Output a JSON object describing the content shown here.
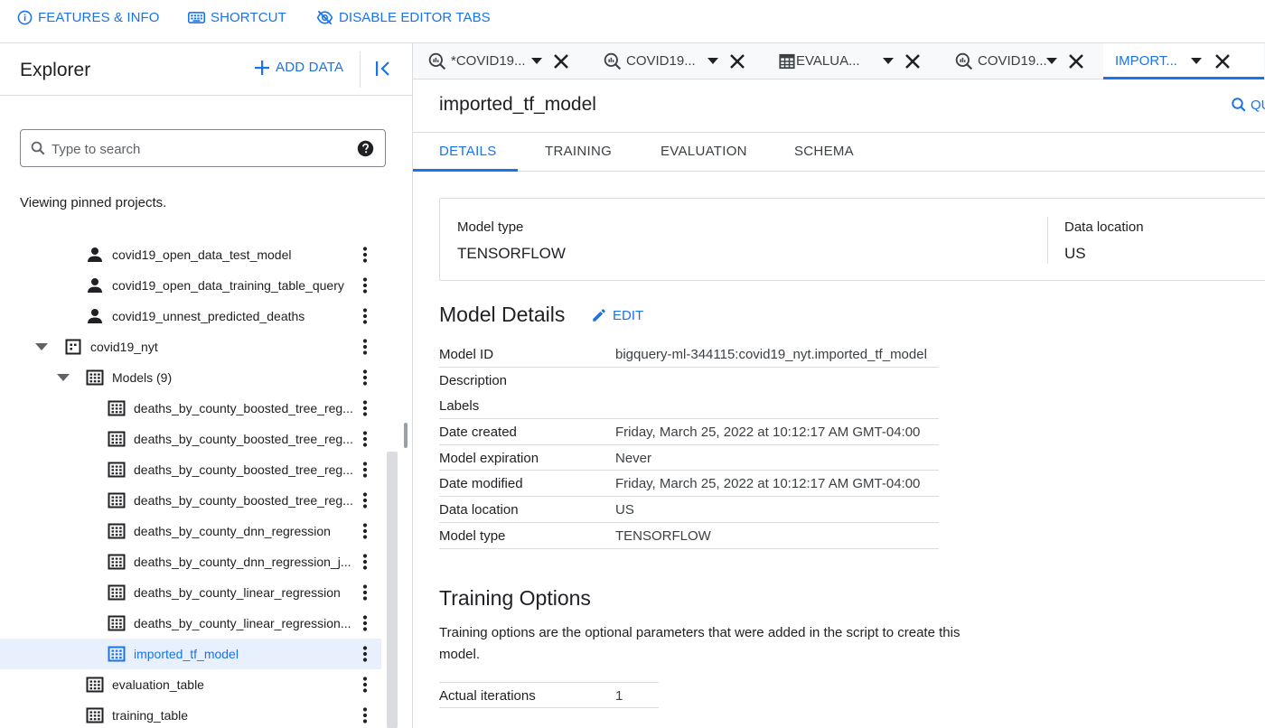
{
  "toolbar": {
    "features_info": "FEATURES & INFO",
    "shortcut": "SHORTCUT",
    "disable_tabs": "DISABLE EDITOR TABS"
  },
  "explorer": {
    "title": "Explorer",
    "add_data": "ADD DATA",
    "search_placeholder": "Type to search",
    "pinned_text": "Viewing pinned projects.",
    "tree": [
      {
        "label": "covid19_open_data_test_model",
        "icon": "person-icon",
        "indent": 1
      },
      {
        "label": "covid19_open_data_training_table_query",
        "icon": "person-icon",
        "indent": 1
      },
      {
        "label": "covid19_unnest_predicted_deaths",
        "icon": "person-icon",
        "indent": 1
      },
      {
        "label": "covid19_nyt",
        "icon": "dataset-icon",
        "indent": 0,
        "expanded": true
      },
      {
        "label": "Models (9)",
        "icon": "model-folder-icon",
        "indent": 1,
        "expanded": true
      },
      {
        "label": "deaths_by_county_boosted_tree_reg...",
        "icon": "model-icon",
        "indent": 2
      },
      {
        "label": "deaths_by_county_boosted_tree_reg...",
        "icon": "model-icon",
        "indent": 2
      },
      {
        "label": "deaths_by_county_boosted_tree_reg...",
        "icon": "model-icon",
        "indent": 2
      },
      {
        "label": "deaths_by_county_boosted_tree_reg...",
        "icon": "model-icon",
        "indent": 2
      },
      {
        "label": "deaths_by_county_dnn_regression",
        "icon": "model-icon",
        "indent": 2
      },
      {
        "label": "deaths_by_county_dnn_regression_j...",
        "icon": "model-icon",
        "indent": 2
      },
      {
        "label": "deaths_by_county_linear_regression",
        "icon": "model-icon",
        "indent": 2
      },
      {
        "label": "deaths_by_county_linear_regression...",
        "icon": "model-icon",
        "indent": 2
      },
      {
        "label": "imported_tf_model",
        "icon": "model-icon",
        "indent": 2,
        "selected": true
      },
      {
        "label": "evaluation_table",
        "icon": "table-icon",
        "indent": 1
      },
      {
        "label": "training_table",
        "icon": "table-icon",
        "indent": 1
      }
    ]
  },
  "editor_tabs": [
    {
      "label": "*COVID19...",
      "icon": "query-icon"
    },
    {
      "label": "COVID19...",
      "icon": "query-icon"
    },
    {
      "label": "EVALUA...",
      "icon": "table-icon"
    },
    {
      "label": "COVID19...",
      "icon": "query-icon"
    },
    {
      "label": "IMPORT...",
      "icon": "none",
      "active": true
    }
  ],
  "model": {
    "title": "imported_tf_model",
    "query_label": "QU",
    "subtabs": [
      "DETAILS",
      "TRAINING",
      "EVALUATION",
      "SCHEMA"
    ],
    "summary": {
      "model_type_label": "Model type",
      "model_type_value": "TENSORFLOW",
      "data_location_label": "Data location",
      "data_location_value": "US"
    },
    "details_title": "Model Details",
    "edit_label": "EDIT",
    "details": [
      {
        "key": "Model ID",
        "value": "bigquery-ml-344115:covid19_nyt.imported_tf_model"
      },
      {
        "key": "Description",
        "value": ""
      },
      {
        "key": "Labels",
        "value": ""
      },
      {
        "key": "Date created",
        "value": "Friday, March 25, 2022 at 10:12:17 AM GMT-04:00"
      },
      {
        "key": "Model expiration",
        "value": "Never"
      },
      {
        "key": "Date modified",
        "value": "Friday, March 25, 2022 at 10:12:17 AM GMT-04:00"
      },
      {
        "key": "Data location",
        "value": "US"
      },
      {
        "key": "Model type",
        "value": "TENSORFLOW"
      }
    ],
    "training_title": "Training Options",
    "training_desc": "Training options are the optional parameters that were added in the script to create this model.",
    "training_options": [
      {
        "key": "Actual iterations",
        "value": "1"
      }
    ]
  },
  "colors": {
    "accent": "#1a73e8",
    "selected_bg": "#e8f0fe",
    "divider": "#dadce0"
  }
}
